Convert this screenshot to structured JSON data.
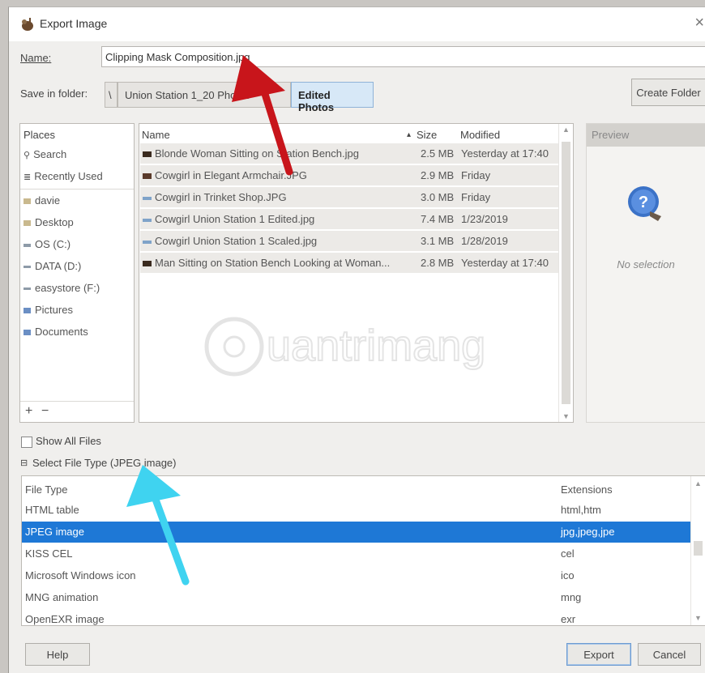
{
  "window": {
    "title": "Export Image",
    "close_label": "×"
  },
  "name": {
    "label": "Name:",
    "value": "Clipping Mask Composition.jpg"
  },
  "folder": {
    "label": "Save in folder:",
    "crumb_arrow": "\\",
    "path": [
      "Union Station 1_20 Photos",
      "Edited Photos"
    ],
    "create_folder_label": "Create Folder"
  },
  "places": {
    "header": "Places",
    "items": [
      {
        "label": "Search",
        "icon": "search-icon"
      },
      {
        "label": "Recently Used",
        "icon": "recent-icon"
      },
      {
        "label": "davie",
        "icon": "folder-icon"
      },
      {
        "label": "Desktop",
        "icon": "folder-icon"
      },
      {
        "label": "OS (C:)",
        "icon": "drive-icon"
      },
      {
        "label": "DATA (D:)",
        "icon": "drive-icon"
      },
      {
        "label": "easystore (F:)",
        "icon": "drive-icon"
      },
      {
        "label": "Pictures",
        "icon": "pictures-folder-icon"
      },
      {
        "label": "Documents",
        "icon": "documents-folder-icon"
      }
    ],
    "add_label": "+",
    "remove_label": "−"
  },
  "files": {
    "columns": {
      "name": "Name",
      "size": "Size",
      "modified": "Modified",
      "sort_indicator": "▴"
    },
    "rows": [
      {
        "name": "Blonde Woman Sitting on Station Bench.jpg",
        "size": "2.5 MB",
        "modified": "Yesterday at 17:40"
      },
      {
        "name": "Cowgirl in Elegant Armchair.JPG",
        "size": "2.9 MB",
        "modified": "Friday"
      },
      {
        "name": "Cowgirl in Trinket Shop.JPG",
        "size": "3.0 MB",
        "modified": "Friday"
      },
      {
        "name": "Cowgirl Union Station 1 Edited.jpg",
        "size": "7.4 MB",
        "modified": "1/23/2019"
      },
      {
        "name": "Cowgirl Union Station 1 Scaled.jpg",
        "size": "3.1 MB",
        "modified": "1/28/2019"
      },
      {
        "name": "Man Sitting on Station Bench Looking at Woman...",
        "size": "2.8 MB",
        "modified": "Yesterday at 17:40"
      }
    ]
  },
  "preview": {
    "header": "Preview",
    "status": "No selection"
  },
  "show_all_files": {
    "label": "Show All Files",
    "checked": false
  },
  "file_type": {
    "expander_label": "Select File Type (JPEG image)",
    "expander_glyph": "⊟",
    "columns": {
      "type": "File Type",
      "ext": "Extensions"
    },
    "rows": [
      {
        "type": "HTML table",
        "ext": "html,htm"
      },
      {
        "type": "JPEG image",
        "ext": "jpg,jpeg,jpe",
        "selected": true
      },
      {
        "type": "KISS CEL",
        "ext": "cel"
      },
      {
        "type": "Microsoft Windows icon",
        "ext": "ico"
      },
      {
        "type": "MNG animation",
        "ext": "mng"
      },
      {
        "type": "OpenEXR image",
        "ext": "exr"
      }
    ]
  },
  "buttons": {
    "help": "Help",
    "export": "Export",
    "cancel": "Cancel"
  },
  "watermark": {
    "text": "uantrimang"
  },
  "colors": {
    "selection": "#1e78d6",
    "red_arrow": "#c8151b",
    "cyan_arrow": "#3fd3f0"
  }
}
